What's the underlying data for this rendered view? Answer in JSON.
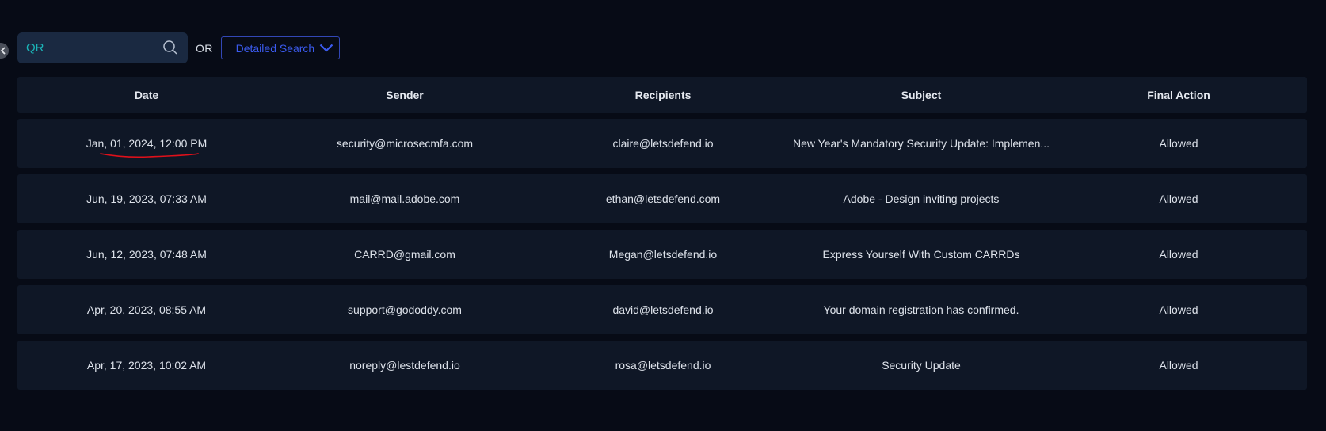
{
  "search": {
    "value": "QR",
    "or_label": "OR",
    "detailed_search_label": "Detailed Search"
  },
  "table": {
    "headers": [
      "Date",
      "Sender",
      "Recipients",
      "Subject",
      "Final Action"
    ],
    "rows": [
      [
        "Jan, 01, 2024, 12:00 PM",
        "security@microsecmfa.com",
        "claire@letsdefend.io",
        "New Year's Mandatory Security Update: Implemen...",
        "Allowed"
      ],
      [
        "Jun, 19, 2023, 07:33 AM",
        "mail@mail.adobe.com",
        "ethan@letsdefend.com",
        "Adobe - Design inviting projects",
        "Allowed"
      ],
      [
        "Jun, 12, 2023, 07:48 AM",
        "CARRD@gmail.com",
        "Megan@letsdefend.io",
        "Express Yourself With Custom CARRDs",
        "Allowed"
      ],
      [
        "Apr, 20, 2023, 08:55 AM",
        "support@gododdy.com",
        "david@letsdefend.io",
        "Your domain registration has confirmed.",
        "Allowed"
      ],
      [
        "Apr, 17, 2023, 10:02 AM",
        "noreply@lestdefend.io",
        "rosa@letsdefend.io",
        "Security Update",
        "Allowed"
      ]
    ]
  },
  "colors": {
    "background": "#070b16",
    "row_background": "#0f1726",
    "search_background": "#1a2941",
    "search_text": "#1bb5b8",
    "accent_blue": "#3b5bf0",
    "annotation_red": "#e0101a"
  },
  "icons": {
    "edge_toggle": "chevron-left-icon",
    "search": "search-icon",
    "dropdown": "chevron-down-icon"
  }
}
